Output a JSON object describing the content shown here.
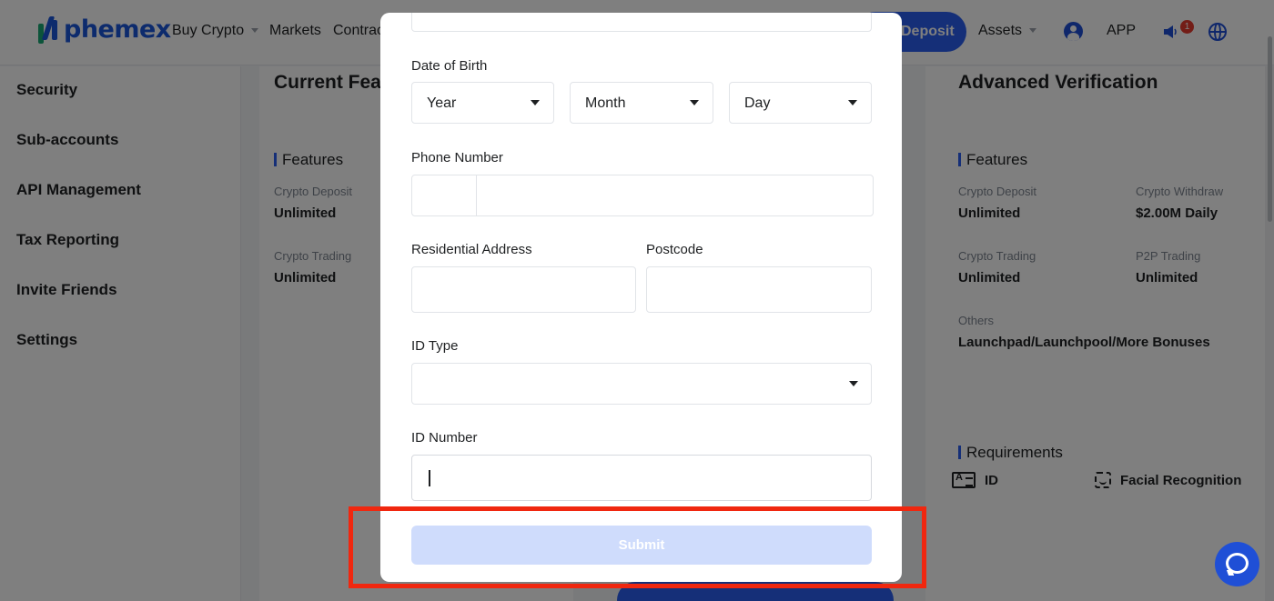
{
  "topbar": {
    "logo_text": "phemex",
    "nav": [
      {
        "label": "Buy Crypto"
      },
      {
        "label": "Markets"
      },
      {
        "label": "Contrac"
      }
    ],
    "deposit_label": "Deposit",
    "assets_label": "Assets",
    "app_label": "APP",
    "notification_count": "1"
  },
  "sidebar": {
    "items": [
      {
        "label": "Security"
      },
      {
        "label": "Sub-accounts"
      },
      {
        "label": "API Management"
      },
      {
        "label": "Tax Reporting"
      },
      {
        "label": "Invite Friends"
      },
      {
        "label": "Settings"
      }
    ]
  },
  "current_card": {
    "title": "Current Fea",
    "features_heading": "Features",
    "features": [
      {
        "label": "Crypto Deposit",
        "value": "Unlimited"
      },
      {
        "label": "Crypto Trading",
        "value": "Unlimited"
      }
    ]
  },
  "advanced_card": {
    "title": "Advanced Verification",
    "features_heading": "Features",
    "features": [
      {
        "label": "Crypto Deposit",
        "value": "Unlimited"
      },
      {
        "label": "Crypto Withdraw",
        "value": "$2.00M Daily"
      },
      {
        "label": "Crypto Trading",
        "value": "Unlimited"
      },
      {
        "label": "P2P Trading",
        "value": "Unlimited"
      },
      {
        "label": "Others",
        "value": "Launchpad/Launchpool/More Bonuses"
      }
    ],
    "requirements_heading": "Requirements",
    "requirements": [
      {
        "label": "ID"
      },
      {
        "label": "Facial Recognition"
      }
    ]
  },
  "modal": {
    "dob_label": "Date of Birth",
    "year_placeholder": "Year",
    "month_placeholder": "Month",
    "day_placeholder": "Day",
    "phone_label": "Phone Number",
    "address_label": "Residential Address",
    "postcode_label": "Postcode",
    "id_type_label": "ID Type",
    "id_number_label": "ID Number",
    "submit_label": "Submit"
  },
  "colors": {
    "brand": "#2a5ff0",
    "submit_disabled": "#cfdcfc",
    "highlight": "#f0270f"
  }
}
